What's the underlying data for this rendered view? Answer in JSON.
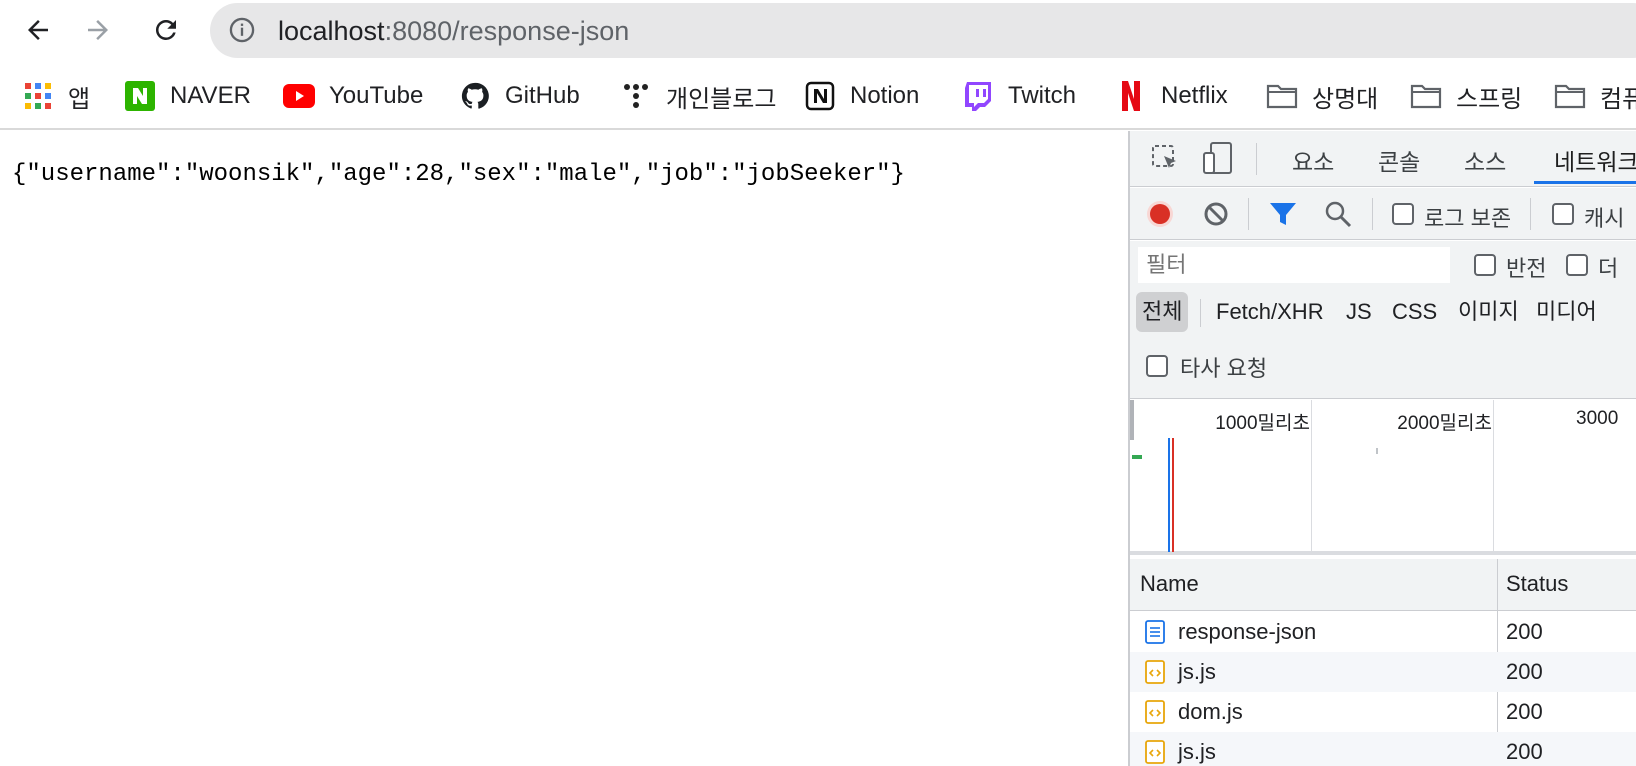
{
  "toolbar": {
    "url_host": "localhost",
    "url_rest": ":8080/response-json"
  },
  "bookmarks": [
    {
      "label": "앱",
      "icon": "apps-grid-icon"
    },
    {
      "label": "NAVER",
      "icon": "naver-icon"
    },
    {
      "label": "YouTube",
      "icon": "youtube-icon"
    },
    {
      "label": "GitHub",
      "icon": "github-icon"
    },
    {
      "label": "개인블로그",
      "icon": "tistory-icon"
    },
    {
      "label": "Notion",
      "icon": "notion-icon"
    },
    {
      "label": "Twitch",
      "icon": "twitch-icon"
    },
    {
      "label": "Netflix",
      "icon": "netflix-icon"
    },
    {
      "label": "상명대",
      "icon": "folder-icon"
    },
    {
      "label": "스프링",
      "icon": "folder-icon"
    },
    {
      "label": "컴퓨",
      "icon": "folder-icon"
    }
  ],
  "page": {
    "json_text": "{\"username\":\"woonsik\",\"age\":28,\"sex\":\"male\",\"job\":\"jobSeeker\"}"
  },
  "devtools": {
    "tabs": [
      "요소",
      "콘솔",
      "소스",
      "네트워크"
    ],
    "active_tab": "네트워크",
    "preserve_log_label": "로그 보존",
    "disable_cache_label": "캐시",
    "filter_placeholder": "필터",
    "invert_label": "반전",
    "more_label": "더",
    "type_filters": [
      "전체",
      "Fetch/XHR",
      "JS",
      "CSS",
      "이미지",
      "미디어"
    ],
    "active_type": "전체",
    "third_party_label": "타사 요청",
    "timeline_labels": [
      "1000밀리초",
      "2000밀리초",
      "3000"
    ],
    "columns": [
      "Name",
      "Status"
    ],
    "requests": [
      {
        "name": "response-json",
        "status": "200",
        "type": "document"
      },
      {
        "name": "js.js",
        "status": "200",
        "type": "script"
      },
      {
        "name": "dom.js",
        "status": "200",
        "type": "script"
      },
      {
        "name": "js.js",
        "status": "200",
        "type": "script"
      }
    ],
    "colors": {
      "record": "#d93025",
      "accent": "#1a73e8",
      "script_icon": "#e8a60b"
    }
  }
}
